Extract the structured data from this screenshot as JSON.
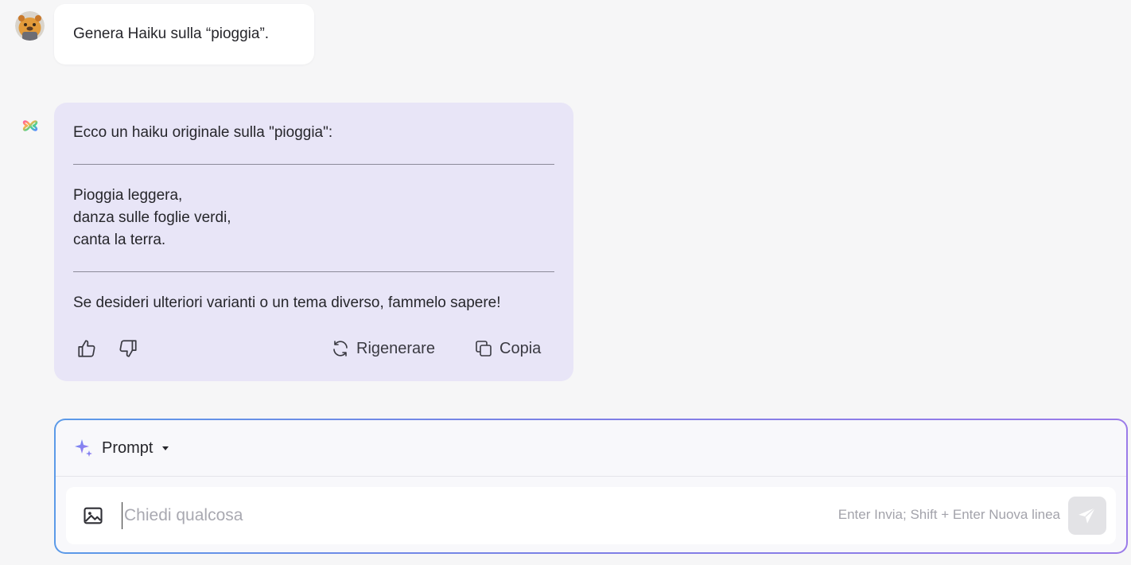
{
  "user_message": {
    "text": "Genera Haiku sulla “pioggia”.",
    "avatar_icon": "beaver-avatar-icon"
  },
  "assistant_message": {
    "logo_icon": "multicolor-flower-logo-icon",
    "intro": "Ecco un haiku originale sulla \"pioggia\":",
    "haiku_lines": [
      "Pioggia leggera,",
      "danza sulle foglie verdi,",
      "canta la terra."
    ],
    "outro": "Se desideri ulteriori varianti o un tema diverso, fammelo sapere!",
    "actions": {
      "like_icon": "thumbs-up-icon",
      "dislike_icon": "thumbs-down-icon",
      "regenerate_label": "Rigenerare",
      "copy_label": "Copia"
    }
  },
  "composer": {
    "prompt_label": "Prompt",
    "input_placeholder": "Chiedi qualcosa",
    "input_value": "",
    "hint": "Enter Invia; Shift + Enter Nuova linea",
    "send_icon": "paper-plane-icon",
    "image_icon": "image-upload-icon"
  },
  "colors": {
    "assistant_bubble": "#e8e5f7",
    "composer_border_start": "#5b9ae8",
    "composer_border_end": "#9b7be9",
    "sparkle": "#8a7cf0"
  }
}
